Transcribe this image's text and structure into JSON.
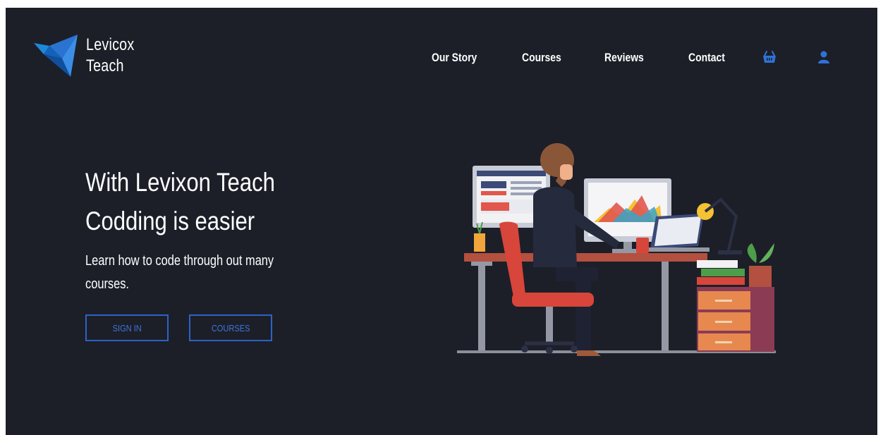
{
  "brand": {
    "line1": "Levicox",
    "line2": "Teach"
  },
  "nav": {
    "items": [
      {
        "label": "Our Story"
      },
      {
        "label": "Courses"
      },
      {
        "label": "Reviews"
      },
      {
        "label": "Contact"
      }
    ],
    "icons": [
      "basket-icon",
      "user-icon"
    ]
  },
  "hero": {
    "title_line1": "With Levixon Teach",
    "title_line2": "Codding is easier",
    "subtitle": "Learn how to code through out many courses.",
    "buttons": {
      "sign_in": "SIGN IN",
      "courses": "COURSES"
    }
  },
  "colors": {
    "background": "#1c1f28",
    "accent": "#2c63c7",
    "text": "#ffffff"
  }
}
